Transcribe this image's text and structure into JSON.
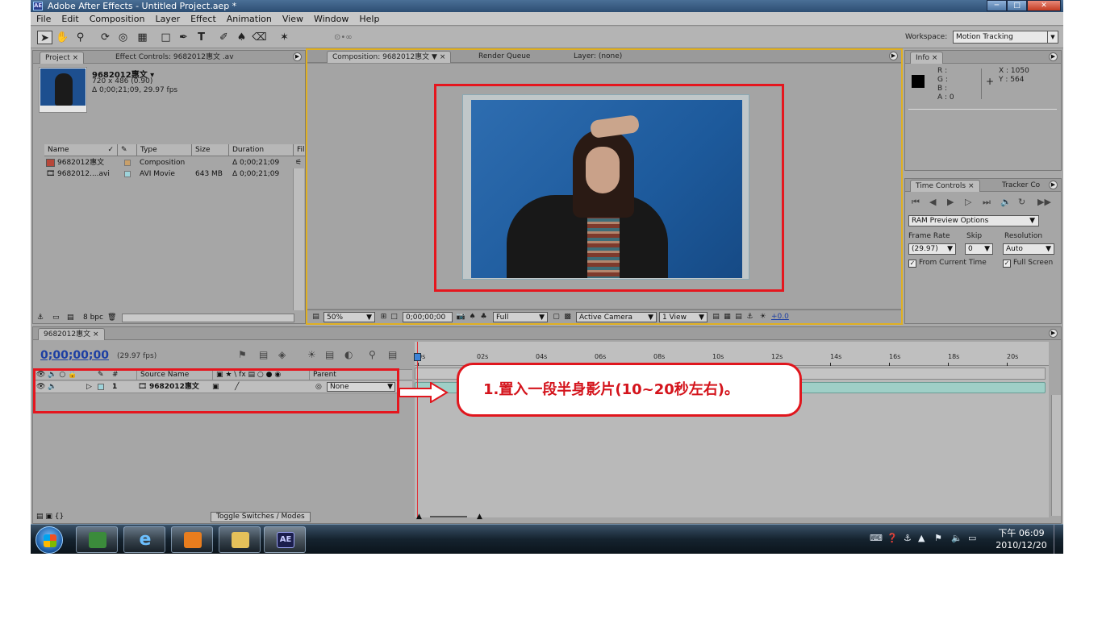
{
  "window": {
    "title": "Adobe After Effects - Untitled Project.aep *",
    "app_icon_text": "AE"
  },
  "menu": [
    "File",
    "Edit",
    "Composition",
    "Layer",
    "Effect",
    "Animation",
    "View",
    "Window",
    "Help"
  ],
  "toolbar": {
    "tools": [
      "selection-tool",
      "hand-tool",
      "zoom-tool",
      "rotation-tool",
      "orbit-camera-tool",
      "pan-behind-tool",
      "rectangle-mask-tool",
      "pen-tool",
      "type-tool",
      "brush-tool",
      "clone-stamp-tool",
      "eraser-tool",
      "puppet-pin-tool"
    ],
    "workspace_label": "Workspace:",
    "workspace_value": "Motion Tracking"
  },
  "project_panel": {
    "tabs": [
      "Project",
      "Effect Controls: 9682012惠文 .av"
    ],
    "item_name": "9682012惠文 ▾",
    "item_dims": "720 x 486 (0.90)",
    "item_duration": "Δ 0;00;21;09, 29.97 fps",
    "columns": [
      "Name",
      "Type",
      "Size",
      "Duration",
      "Fil"
    ],
    "rows": [
      {
        "name": "9682012惠文",
        "type": "Composition",
        "size": "",
        "duration": "Δ 0;00;21;09",
        "color": "#c9a06a"
      },
      {
        "name": "9682012....avi",
        "type": "AVI Movie",
        "size": "643 MB",
        "duration": "Δ 0;00;21;09",
        "color": "#9ed3da"
      }
    ],
    "footer_bpc": "8 bpc"
  },
  "comp_panel": {
    "tabs": [
      "Composition: 9682012惠文",
      "Render Queue",
      "Layer: (none)"
    ],
    "zoom": "50%",
    "timecode": "0;00;00;00",
    "resolution": "Full",
    "camera": "Active Camera",
    "views": "1 View",
    "exposure": "+0.0"
  },
  "info_panel": {
    "tab": "Info",
    "r": "R :",
    "g": "G :",
    "b": "B :",
    "a": "A : 0",
    "x": "X : 1050",
    "y": "Y : 564"
  },
  "time_controls": {
    "tabs": [
      "Time Controls",
      "Tracker Co"
    ],
    "preview_options": "RAM Preview Options",
    "frame_rate_label": "Frame Rate",
    "skip_label": "Skip",
    "resolution_label": "Resolution",
    "frame_rate": "(29.97)",
    "skip": "0",
    "resolution": "Auto",
    "from_current": "From Current Time",
    "full_screen": "Full Screen"
  },
  "timeline": {
    "tab": "9682012惠文",
    "timecode": "0;00;00;00",
    "fps": "(29.97 fps)",
    "columns": [
      "#",
      "Source Name",
      "Parent"
    ],
    "layer": {
      "index": "1",
      "name": "9682012惠文",
      "parent": "None"
    },
    "ruler_ticks": [
      "0s",
      "02s",
      "04s",
      "06s",
      "08s",
      "10s",
      "12s",
      "14s",
      "16s",
      "18s",
      "20s"
    ],
    "toggle_label": "Toggle Switches / Modes"
  },
  "annotation": "1.置入一段半身影片(10~20秒左右)。",
  "taskbar": {
    "clock_time": "下午 06:09",
    "clock_date": "2010/12/20",
    "pinned": [
      "windows-live-icon",
      "internet-explorer-icon",
      "media-player-icon",
      "explorer-folder-icon",
      "after-effects-icon"
    ],
    "ae_label": "AE"
  }
}
